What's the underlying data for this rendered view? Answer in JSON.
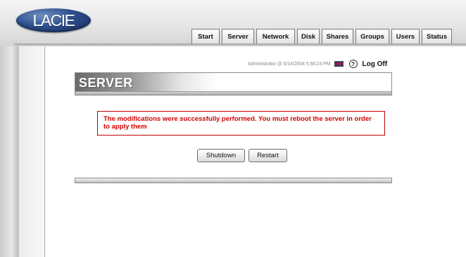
{
  "logo": {
    "text": "LACIE"
  },
  "tabs": [
    {
      "label": "Start"
    },
    {
      "label": "Server"
    },
    {
      "label": "Network"
    },
    {
      "label": "Disk"
    },
    {
      "label": "Shares"
    },
    {
      "label": "Groups"
    },
    {
      "label": "Users"
    },
    {
      "label": "Status"
    }
  ],
  "userbar": {
    "info": "Administrator @ 6/14/2004 5:58:24 PM",
    "help_glyph": "?",
    "logoff_label": "Log Off",
    "flag_icon": "uk-flag-icon"
  },
  "section": {
    "title": "SERVER"
  },
  "message": {
    "text": "The modifications were successfully performed. You must reboot the server in order to apply them",
    "color": "#d00000"
  },
  "buttons": {
    "shutdown_label": "Shutdown",
    "restart_label": "Restart"
  },
  "colors": {
    "logo_blue": "#2d4f8c",
    "message_red": "#d00000"
  }
}
